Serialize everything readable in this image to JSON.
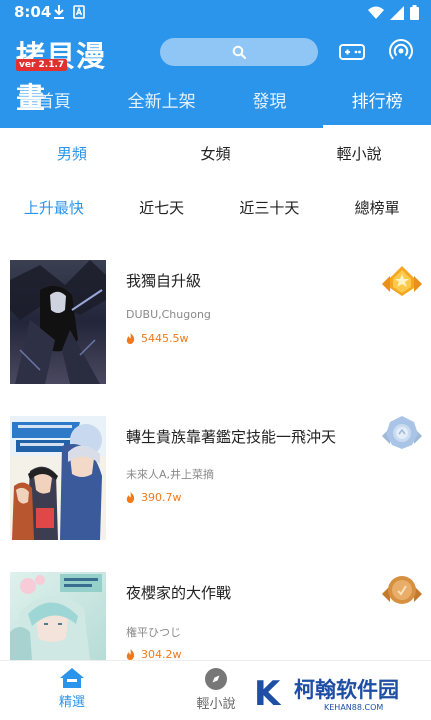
{
  "status_bar": {
    "time": "8:04"
  },
  "app": {
    "logo_text": "拷貝漫畫",
    "version": "ver 2.1.7"
  },
  "main_tabs": [
    {
      "label": "首頁"
    },
    {
      "label": "全新上架"
    },
    {
      "label": "發現"
    },
    {
      "label": "排行榜"
    }
  ],
  "category_tabs": [
    {
      "label": "男頻"
    },
    {
      "label": "女頻"
    },
    {
      "label": "輕小說"
    }
  ],
  "period_tabs": [
    {
      "label": "上升最快"
    },
    {
      "label": "近七天"
    },
    {
      "label": "近三十天"
    },
    {
      "label": "總榜單"
    }
  ],
  "rank_items": [
    {
      "title": "我獨自升級",
      "author": "DUBU,Chugong",
      "heat": "5445.5w",
      "medal": "gold",
      "medal_color": "#f5a623"
    },
    {
      "title": "轉生貴族靠著鑑定技能一飛沖天",
      "author": "未來人A,井上菜摘",
      "heat": "390.7w",
      "medal": "silver",
      "medal_color": "#a9c4e6"
    },
    {
      "title": "夜櫻家的大作戰",
      "author": "権平ひつじ",
      "heat": "304.2w",
      "medal": "bronze",
      "medal_color": "#d69040"
    }
  ],
  "bottom_nav": [
    {
      "label": "精選",
      "icon": "home-icon"
    },
    {
      "label": "輕小說",
      "icon": "compass-icon"
    }
  ],
  "watermark": {
    "logo_letter": "K",
    "name": "柯翰软件园",
    "url": "KEHAN88.COM"
  },
  "colors": {
    "primary": "#2b95ec",
    "heat": "#f07a1a",
    "version_badge": "#e0302f"
  }
}
